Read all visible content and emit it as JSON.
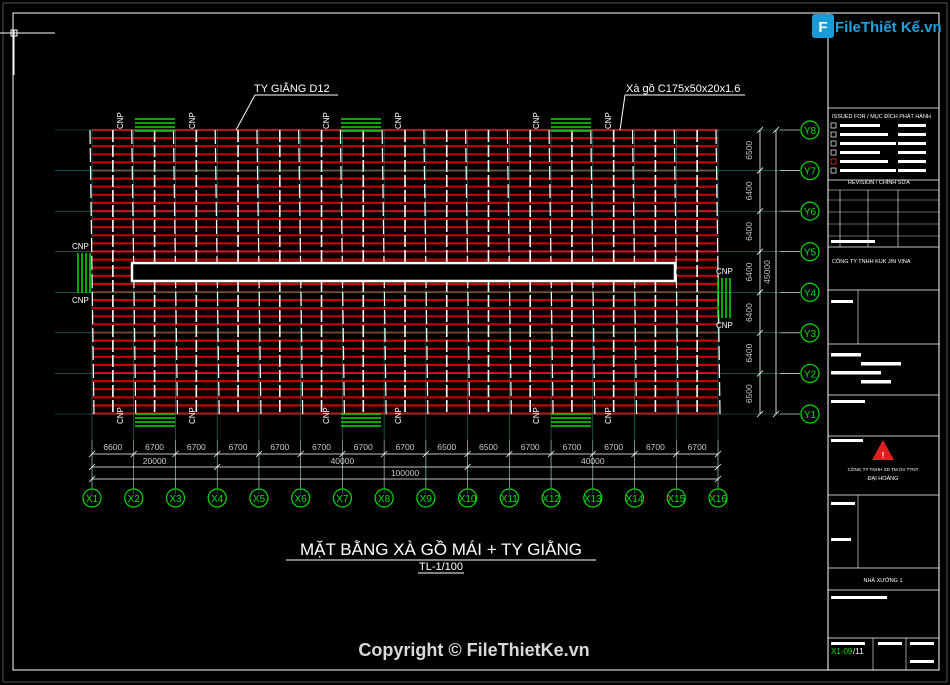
{
  "logo": {
    "text": "FileThiết Kế.vn"
  },
  "title": {
    "main": "MẶT BẰNG XÀ GỒ MÁI + TY GIẰNG",
    "scale": "TL-1/100"
  },
  "labels": {
    "tie_rod": "TY GIẰNG D12",
    "purlin": "Xà gồ C175x50x20x1.6",
    "bracing": "CNP"
  },
  "grid_x": [
    "X1",
    "X2",
    "X3",
    "X4",
    "X5",
    "X6",
    "X7",
    "X8",
    "X9",
    "X10",
    "X11",
    "X12",
    "X13",
    "X14",
    "X15",
    "X16"
  ],
  "grid_y": [
    "Y8",
    "Y7",
    "Y6",
    "Y5",
    "Y4",
    "Y3",
    "Y2",
    "Y1"
  ],
  "dims_x": [
    "6600",
    "6700",
    "6700",
    "6700",
    "6700",
    "6700",
    "6700",
    "6700",
    "6500",
    "6500",
    "6700",
    "6700",
    "6700",
    "6700",
    "6700"
  ],
  "dims_x_groups": [
    "20000",
    "40000",
    "40000"
  ],
  "dims_x_total": "100000",
  "dims_y": [
    "6500",
    "6400",
    "6400",
    "6400",
    "6400",
    "6400",
    "6500"
  ],
  "dims_y_total": "45000",
  "title_block": {
    "issued_for": "ISSUED FOR  / MỤC ĐÍCH PHÁT HÀNH",
    "revision": "REVISION  / CHỈNH SỬA",
    "client": "CÔNG TY TNHH KUK JIN VINA",
    "contractor_line1": "CÔNG TY TNHH XD TM DV TTNT",
    "contractor_line2": "ĐẠI HOÀNG",
    "project": "NHÀ XƯỞNG 1",
    "sheet_no": "X1-09",
    "sheet_total": "/11"
  },
  "copyright": "Copyright © FileThietKe.vn"
}
